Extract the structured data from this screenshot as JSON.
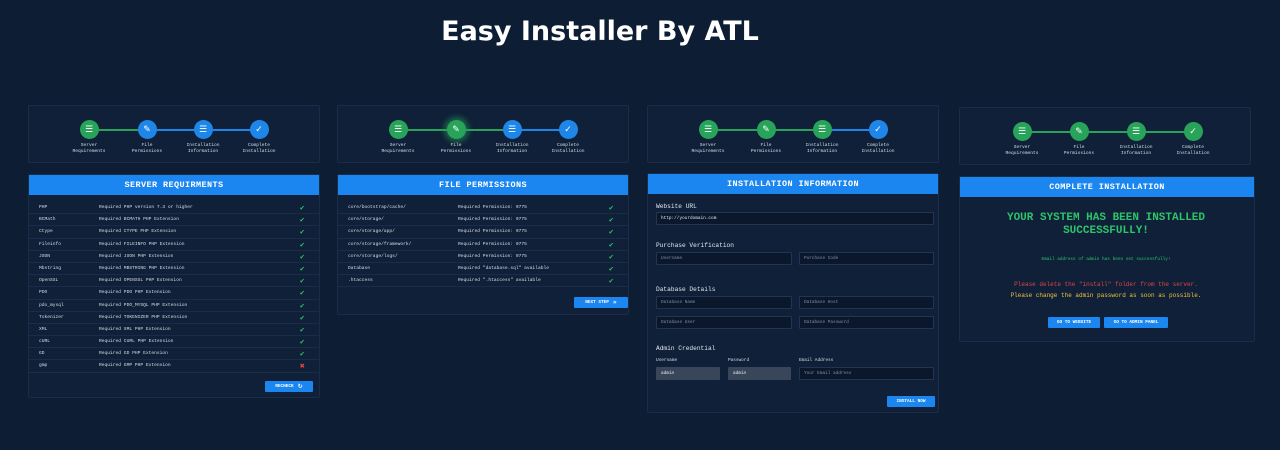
{
  "title": "Easy Installer By ATL",
  "stepper": {
    "steps": [
      "Server\nRequirements",
      "File\nPermissions",
      "Installation\nInformation",
      "Complete\nInstallation"
    ],
    "icons": [
      "list-icon",
      "file-edit-icon",
      "database-icon",
      "check-circle-icon"
    ],
    "colors": {
      "done": "#28a35a",
      "pending": "#1e86e8"
    }
  },
  "server": {
    "title": "SERVER REQUIRMENTS",
    "rows": [
      {
        "name": "PHP",
        "desc": "Required PHP version 7.3 or higher",
        "ok": true
      },
      {
        "name": "BCMath",
        "desc": "Required BCMATH PHP Extension",
        "ok": true
      },
      {
        "name": "Ctype",
        "desc": "Required CTYPE PHP Extension",
        "ok": true
      },
      {
        "name": "Fileinfo",
        "desc": "Required FILEINFO PHP Extension",
        "ok": true
      },
      {
        "name": "JSON",
        "desc": "Required JSON PHP Extension",
        "ok": true
      },
      {
        "name": "Mbstring",
        "desc": "Required MBSTRING PHP Extension",
        "ok": true
      },
      {
        "name": "OpenSSL",
        "desc": "Required OPENSSL PHP Extension",
        "ok": true
      },
      {
        "name": "PDO",
        "desc": "Required PDO PHP Extension",
        "ok": true
      },
      {
        "name": "pdo_mysql",
        "desc": "Required PDO_MYSQL PHP Extension",
        "ok": true
      },
      {
        "name": "Tokenizer",
        "desc": "Required TOKENIZER PHP Extension",
        "ok": true
      },
      {
        "name": "XML",
        "desc": "Required XML PHP Extension",
        "ok": true
      },
      {
        "name": "cURL",
        "desc": "Required CURL PHP Extension",
        "ok": true
      },
      {
        "name": "GD",
        "desc": "Required GD PHP Extension",
        "ok": true
      },
      {
        "name": "gmp",
        "desc": "Required GMP PHP Extension",
        "ok": false
      }
    ],
    "button": "RECHECK",
    "button_icon": "refresh-icon"
  },
  "files": {
    "title": "FILE PERMISSIONS",
    "rows": [
      {
        "name": "core/bootstrap/cache/",
        "desc": "Required Permission: 0775",
        "ok": true
      },
      {
        "name": "core/storage/",
        "desc": "Required Permission: 0775",
        "ok": true
      },
      {
        "name": "core/storage/app/",
        "desc": "Required Permission: 0775",
        "ok": true
      },
      {
        "name": "core/storage/framework/",
        "desc": "Required Permission: 0775",
        "ok": true
      },
      {
        "name": "core/storage/logs/",
        "desc": "Required Permission: 0775",
        "ok": true
      },
      {
        "name": "Database",
        "desc": "Required \"database.sql\" available",
        "ok": true
      },
      {
        "name": ".htaccess",
        "desc": "Required \".htaccess\" available",
        "ok": true
      }
    ],
    "button": "NEXT STEP",
    "button_icon": "double-chevron-right-icon"
  },
  "install": {
    "title": "INSTALLATION INFORMATION",
    "website_label": "Website URL",
    "website_value": "http://yourdomain.com",
    "purchase_label": "Purchase Verification",
    "username_placeholder": "Username",
    "purchase_code_placeholder": "Purchase Code",
    "db_label": "Database Details",
    "db_name_placeholder": "Database Name",
    "db_host_placeholder": "Database Host",
    "db_user_placeholder": "Database User",
    "db_password_placeholder": "Database Password",
    "admin_label": "Admin Credential",
    "admin_username_label": "Username",
    "admin_password_label": "Password",
    "admin_email_label": "Email Address",
    "admin_username_value": "admin",
    "admin_password_value": "admin",
    "admin_email_placeholder": "Your Email address",
    "button": "INSTALL NOW"
  },
  "complete": {
    "title": "COMPLETE INSTALLATION",
    "headline": "YOUR SYSTEM HAS BEEN INSTALLED SUCCESSFULLY!",
    "email_note": "Email address of admin has been set successfully!",
    "warning1": "Please delete the \"install\" folder from the server.",
    "warning2": "Please change the admin password as soon as possible.",
    "btn_website": "GO TO WEBSITE",
    "btn_admin": "GO TO ADMIN PANEL"
  }
}
